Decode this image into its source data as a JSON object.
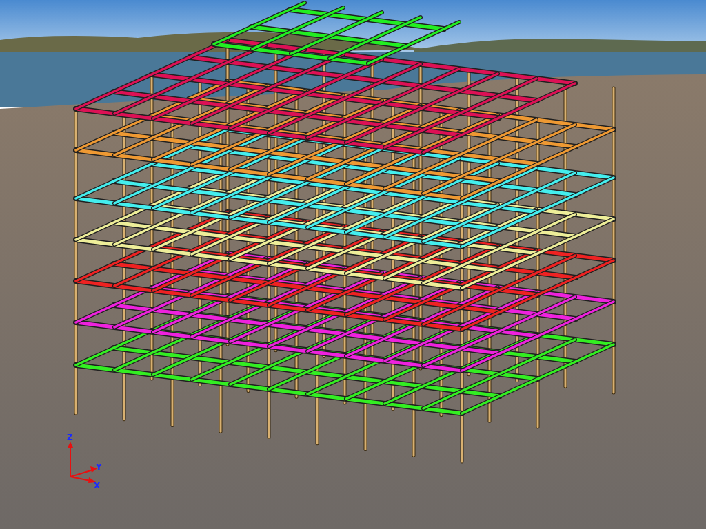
{
  "viewport": {
    "axis_labels": [
      "Z",
      "Y",
      "X"
    ]
  }
}
